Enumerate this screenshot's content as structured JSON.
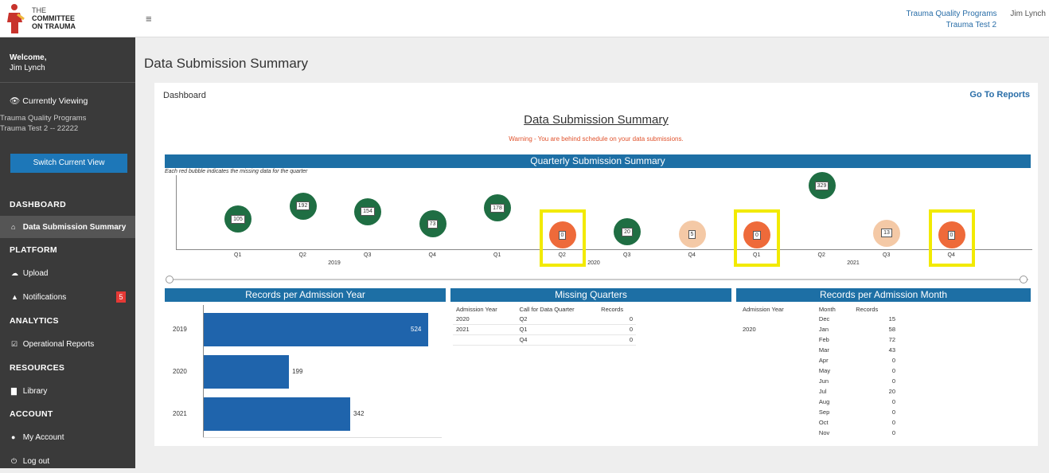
{
  "header": {
    "logo_line1": "THE",
    "logo_line2": "COMMITTEE",
    "logo_line3": "ON TRAUMA",
    "menu_glyph": "≡",
    "program": "Trauma Quality Programs",
    "user": "Jim Lynch",
    "context": "Trauma Test 2"
  },
  "sidebar": {
    "welcome": "Welcome,",
    "welcome_name": "Jim Lynch",
    "viewing_label": "Currently Viewing",
    "viewing_line1": "Trauma Quality Programs",
    "viewing_line2": "Trauma Test 2 -- 22222",
    "switch_button": "Switch Current View",
    "sections": {
      "dashboard": "DASHBOARD",
      "platform": "PLATFORM",
      "analytics": "ANALYTICS",
      "resources": "RESOURCES",
      "account": "ACCOUNT"
    },
    "items": {
      "data_submission": "Data Submission Summary",
      "upload": "Upload",
      "notifications": "Notifications",
      "notifications_count": "5",
      "operational_reports": "Operational Reports",
      "library": "Library",
      "my_account": "My Account",
      "log_out": "Log out"
    }
  },
  "main": {
    "page_title": "Data Submission Summary",
    "dashboard_label": "Dashboard",
    "go_to_reports": "Go To Reports",
    "summary_title": "Data Submission Summary",
    "warning": "Warning - You are behind schedule on your data submissions.",
    "quarterly_header": "Quarterly Submission Summary",
    "quarterly_note": "Each red bubble indicates the missing data for the quarter",
    "records_year_header": "Records per Admission Year",
    "missing_header": "Missing Quarters",
    "records_month_header": "Records per Admission Month"
  },
  "colors": {
    "submitted": "#1f6e43",
    "missing": "#ee6a3a",
    "partial": "#f4c9a6",
    "highlight": "#f2ea00",
    "header_bar": "#1d6fa5",
    "bar": "#1f64ac"
  },
  "chart_data": [
    {
      "type": "scatter",
      "title": "Quarterly Submission Summary",
      "x_quarters": [
        "Q1",
        "Q2",
        "Q3",
        "Q4",
        "Q1",
        "Q2",
        "Q3",
        "Q4",
        "Q1",
        "Q2",
        "Q3",
        "Q4"
      ],
      "x_years": [
        "2019",
        "2020",
        "2021"
      ],
      "values": [
        105,
        192,
        154,
        73,
        178,
        0,
        20,
        5,
        0,
        329,
        13,
        0
      ],
      "status": [
        "submitted",
        "submitted",
        "submitted",
        "submitted",
        "submitted",
        "missing",
        "submitted",
        "partial",
        "missing",
        "submitted",
        "partial",
        "missing"
      ],
      "highlighted": [
        false,
        false,
        false,
        false,
        false,
        true,
        false,
        false,
        true,
        false,
        false,
        true
      ]
    },
    {
      "type": "bar",
      "title": "Records per Admission Year",
      "categories": [
        "2019",
        "2020",
        "2021"
      ],
      "values": [
        524,
        199,
        342
      ]
    },
    {
      "type": "table",
      "title": "Missing Quarters",
      "columns": [
        "Admission Year",
        "Call for Data Quarter",
        "Records"
      ],
      "rows": [
        [
          "2020",
          "Q2",
          "0"
        ],
        [
          "2021",
          "Q1",
          "0"
        ],
        [
          "",
          "Q4",
          "0"
        ]
      ]
    },
    {
      "type": "table",
      "title": "Records per Admission Month",
      "columns": [
        "Admission Year",
        "Month",
        "Records"
      ],
      "rows": [
        [
          "",
          "Dec",
          "15"
        ],
        [
          "2020",
          "Jan",
          "58"
        ],
        [
          "",
          "Feb",
          "72"
        ],
        [
          "",
          "Mar",
          "43"
        ],
        [
          "",
          "Apr",
          "0"
        ],
        [
          "",
          "May",
          "0"
        ],
        [
          "",
          "Jun",
          "0"
        ],
        [
          "",
          "Jul",
          "20"
        ],
        [
          "",
          "Aug",
          "0"
        ],
        [
          "",
          "Sep",
          "0"
        ],
        [
          "",
          "Oct",
          "0"
        ],
        [
          "",
          "Nov",
          "0"
        ]
      ]
    }
  ]
}
